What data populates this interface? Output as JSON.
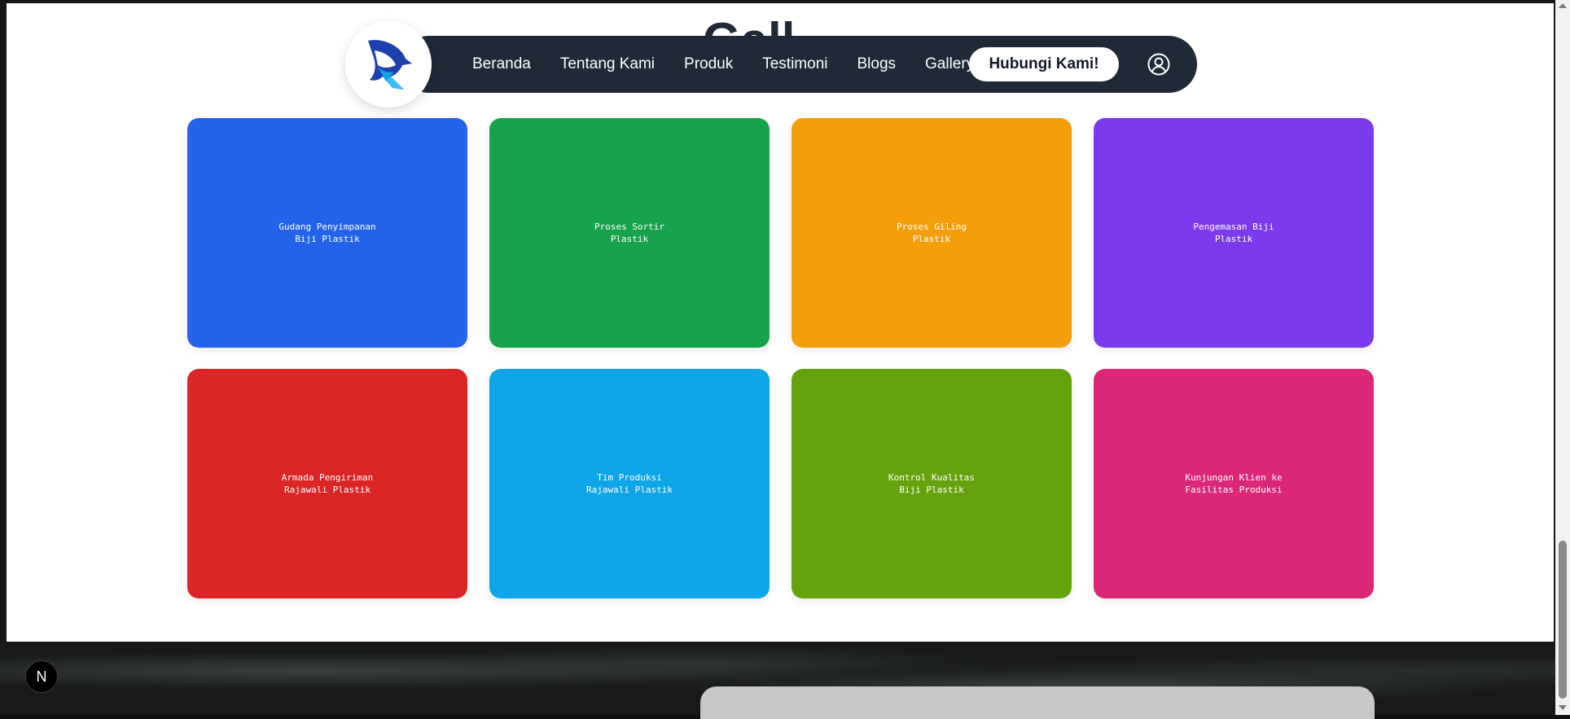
{
  "section": {
    "title_peek": "Gall"
  },
  "nav": {
    "items": [
      {
        "label": "Beranda"
      },
      {
        "label": "Tentang Kami"
      },
      {
        "label": "Produk"
      },
      {
        "label": "Testimoni"
      },
      {
        "label": "Blogs"
      },
      {
        "label": "Gallery"
      }
    ],
    "cta_label": "Hubungi Kami!",
    "user_icon": "user-circle-icon",
    "logo_icon": "eagle-logo-icon"
  },
  "gallery": {
    "cards": [
      {
        "label": "Gudang Penyimpanan Biji Plastik",
        "color": "#2563eb"
      },
      {
        "label": "Proses Sortir Plastik",
        "color": "#16a34a"
      },
      {
        "label": "Proses Giling Plastik",
        "color": "#f59e0b"
      },
      {
        "label": "Pengemasan Biji Plastik",
        "color": "#7c3aed"
      },
      {
        "label": "Armada Pengiriman Rajawali Plastik",
        "color": "#dc2626"
      },
      {
        "label": "Tim Produksi Rajawali Plastik",
        "color": "#0ea5e9"
      },
      {
        "label": "Kontrol Kualitas Biji Plastik",
        "color": "#65a30d"
      },
      {
        "label": "Kunjungan Klien ke Fasilitas Produksi",
        "color": "#db2777"
      }
    ]
  },
  "badge": {
    "label": "N"
  }
}
